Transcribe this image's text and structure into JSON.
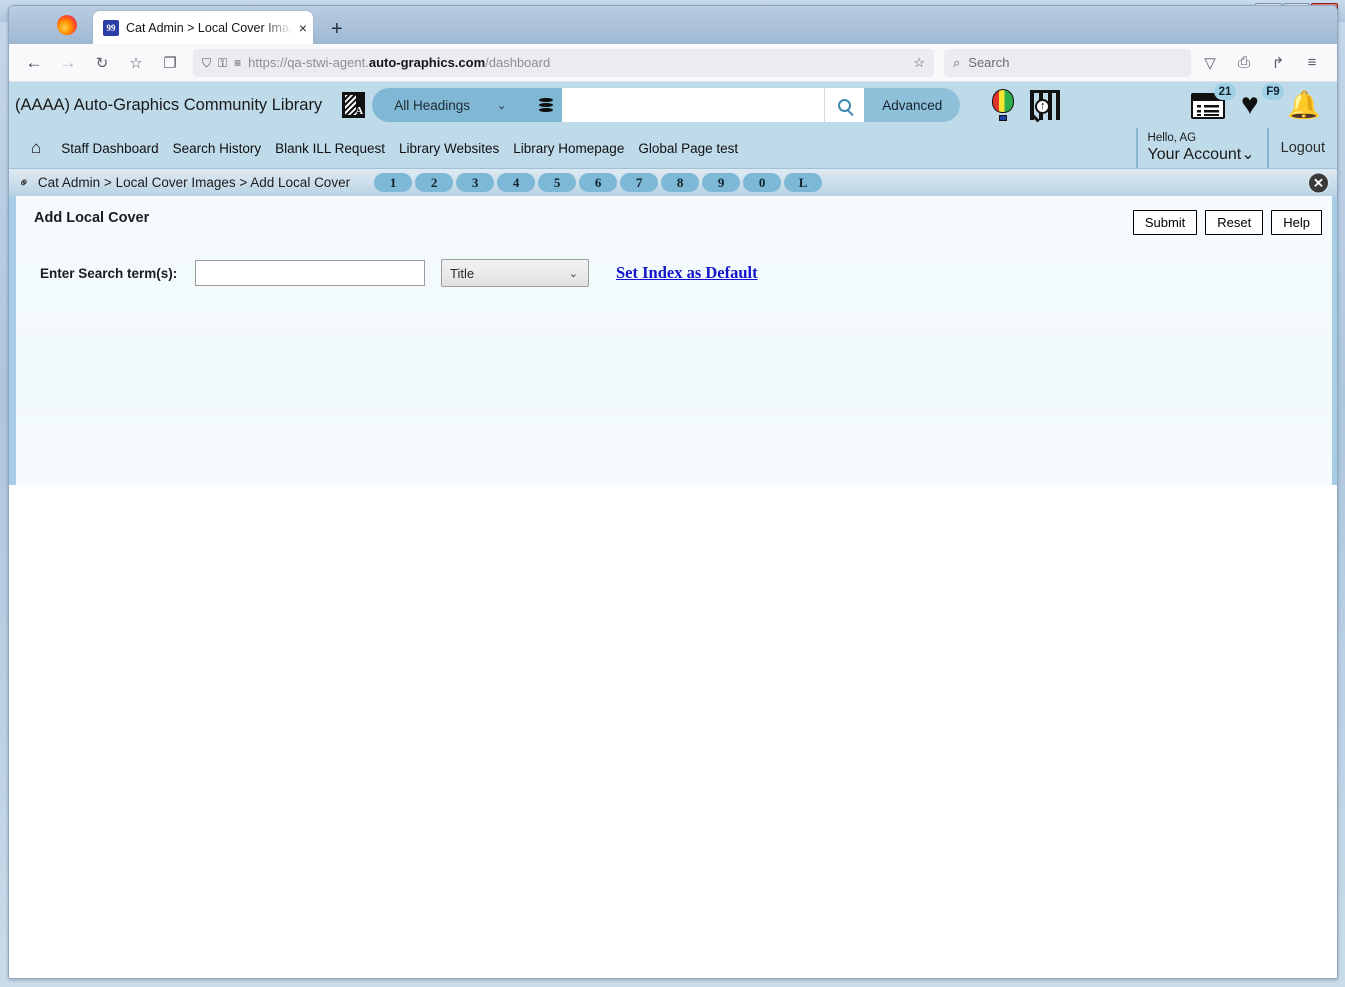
{
  "window": {
    "minimize_label": "Minimize",
    "maximize_label": "Restore",
    "close_label": "Close"
  },
  "browser": {
    "tab": {
      "title": "Cat Admin > Local Cover Images",
      "favicon_text": "99",
      "close_label": "×"
    },
    "new_tab_label": "+",
    "toolbar": {
      "back_icon": "←",
      "forward_icon": "→",
      "reload_icon": "↻",
      "bookmark_icon": "☆",
      "container_icon": "❐",
      "shield_icon": "⛉",
      "lock_icon": "⚿",
      "permissions_icon": "≡",
      "url_prefix": "https://qa-stwi-agent.",
      "url_domain": "auto-graphics.com",
      "url_path": "/dashboard",
      "search_placeholder": "Search",
      "search_icon": "⌕",
      "pocket_icon": "▽",
      "print_icon": "⎙",
      "share_icon": "↱",
      "menu_icon": "≡"
    }
  },
  "app": {
    "library_name": "(AAAA) Auto-Graphics Community Library",
    "search": {
      "alpha_icon": "alphabet-browse-icon",
      "index_selected": "All Headings",
      "database_icon": "database-stack-icon",
      "input_value": "",
      "input_placeholder": "",
      "go_icon": "search-icon",
      "advanced_label": "Advanced"
    },
    "header_icons": [
      {
        "name": "hot-air-balloon-icon"
      },
      {
        "name": "book-scan-icon"
      }
    ],
    "right_icons": [
      {
        "name": "requests-list-icon",
        "badge": "21"
      },
      {
        "name": "favorites-heart-icon",
        "badge": "F9"
      },
      {
        "name": "notifications-bell-icon",
        "badge": ""
      }
    ],
    "nav": {
      "home_icon": "⌂",
      "items": [
        {
          "label": "Staff Dashboard"
        },
        {
          "label": "Search History"
        },
        {
          "label": "Blank ILL Request"
        },
        {
          "label": "Library Websites"
        },
        {
          "label": "Library Homepage"
        },
        {
          "label": "Global Page test"
        }
      ]
    },
    "account": {
      "greeting": "Hello, AG",
      "label": "Your Account⌄",
      "logout_label": "Logout"
    }
  },
  "crumbbar": {
    "link_icon": "⚭",
    "breadcrumb": "Cat Admin > Local Cover Images > Add Local Cover",
    "pills": [
      "1",
      "2",
      "3",
      "4",
      "5",
      "6",
      "7",
      "8",
      "9",
      "0",
      "L"
    ],
    "close_icon": "✕"
  },
  "panel": {
    "title": "Add Local Cover",
    "buttons": {
      "submit": "Submit",
      "reset": "Reset",
      "help": "Help"
    },
    "form": {
      "label": "Enter Search term(s):",
      "term_value": "",
      "term_placeholder": "",
      "index_selected": "Title",
      "index_chevron": "⌄",
      "set_default_link": "Set Index as Default"
    }
  }
}
